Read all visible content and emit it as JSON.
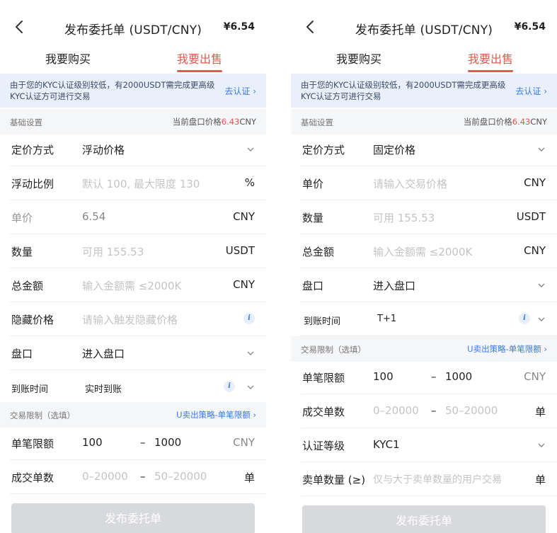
{
  "left": {
    "title": "发布委托单 (USDT/CNY)",
    "price": "¥6.54",
    "tabs": [
      {
        "label": "我要购买"
      },
      {
        "label": "我要出售"
      }
    ],
    "notice": {
      "text": "由于您的KYC认证级别较低，有2000USDT需完成更高级KYC认证方可进行交易",
      "link": "去认证 ›"
    },
    "basic": {
      "label": "基础设置",
      "market_prefix": "当前盘口价格",
      "market_price": "6.43",
      "market_unit": "CNY"
    },
    "pricing_method": {
      "label": "定价方式",
      "value": "浮动价格"
    },
    "float_ratio": {
      "label": "浮动比例",
      "placeholder": "默认 100, 最大限度 130",
      "unit": "%"
    },
    "unit_price": {
      "label": "单价",
      "value": "6.54",
      "unit": "CNY"
    },
    "quantity": {
      "label": "数量",
      "placeholder": "可用 155.53",
      "unit": "USDT"
    },
    "total": {
      "label": "总金额",
      "placeholder": "输入金额需 ≤2000K",
      "unit": "CNY"
    },
    "hidden_price": {
      "label": "隐藏价格",
      "placeholder": "请输入触发隐藏价格"
    },
    "orderbook": {
      "label": "盘口",
      "value": "进入盘口"
    },
    "arrival": {
      "label": "到账时间",
      "value": "实时到账"
    },
    "limits": {
      "label": "交易限制（选填）",
      "link": "U卖出策略-单笔限额 ›"
    },
    "single_limit": {
      "label": "单笔限额",
      "min": "100",
      "dash": "–",
      "max": "1000",
      "unit": "CNY"
    },
    "deal_count": {
      "label": "成交单数",
      "min_placeholder": "0–20000",
      "dash": "–",
      "max_placeholder": "50–20000",
      "unit": "单"
    },
    "submit": "发布委托单"
  },
  "right": {
    "title": "发布委托单 (USDT/CNY)",
    "price": "¥6.54",
    "tabs": [
      {
        "label": "我要购买"
      },
      {
        "label": "我要出售"
      }
    ],
    "notice": {
      "text": "由于您的KYC认证级别较低，有2000USDT需完成更高级KYC认证方可进行交易",
      "link": "去认证 ›"
    },
    "basic": {
      "label": "基础设置",
      "market_prefix": "当前盘口价格",
      "market_price": "6.43",
      "market_unit": "CNY"
    },
    "pricing_method": {
      "label": "定价方式",
      "value": "固定价格"
    },
    "unit_price": {
      "label": "单价",
      "placeholder": "请输入交易价格",
      "unit": "CNY"
    },
    "quantity": {
      "label": "数量",
      "placeholder": "可用 155.53",
      "unit": "USDT"
    },
    "total": {
      "label": "总金额",
      "placeholder": "输入金额需 ≤2000K",
      "unit": "CNY"
    },
    "orderbook": {
      "label": "盘口",
      "value": "进入盘口"
    },
    "arrival": {
      "label": "到账时间",
      "value": "T+1"
    },
    "limits": {
      "label": "交易限制（选填）",
      "link": "U卖出策略-单笔限额 ›"
    },
    "single_limit": {
      "label": "单笔限额",
      "min": "100",
      "dash": "–",
      "max": "1000",
      "unit": "CNY"
    },
    "deal_count": {
      "label": "成交单数",
      "min_placeholder": "0–20000",
      "dash": "–",
      "max_placeholder": "50–20000",
      "unit": "单"
    },
    "kyc_level": {
      "label": "认证等级",
      "value": "KYC1"
    },
    "sell_count": {
      "label": "卖单数量 (≥)",
      "placeholder": "仅与大于卖单数量的用户交易",
      "unit": "单"
    },
    "submit": "发布委托单"
  },
  "colors": {
    "accent": "#e05a4f",
    "link": "#3a7ae6",
    "notice_bg": "#eaf0fb",
    "section_bg": "#f5f6f8",
    "disabled_button": "#d8d9dc"
  }
}
